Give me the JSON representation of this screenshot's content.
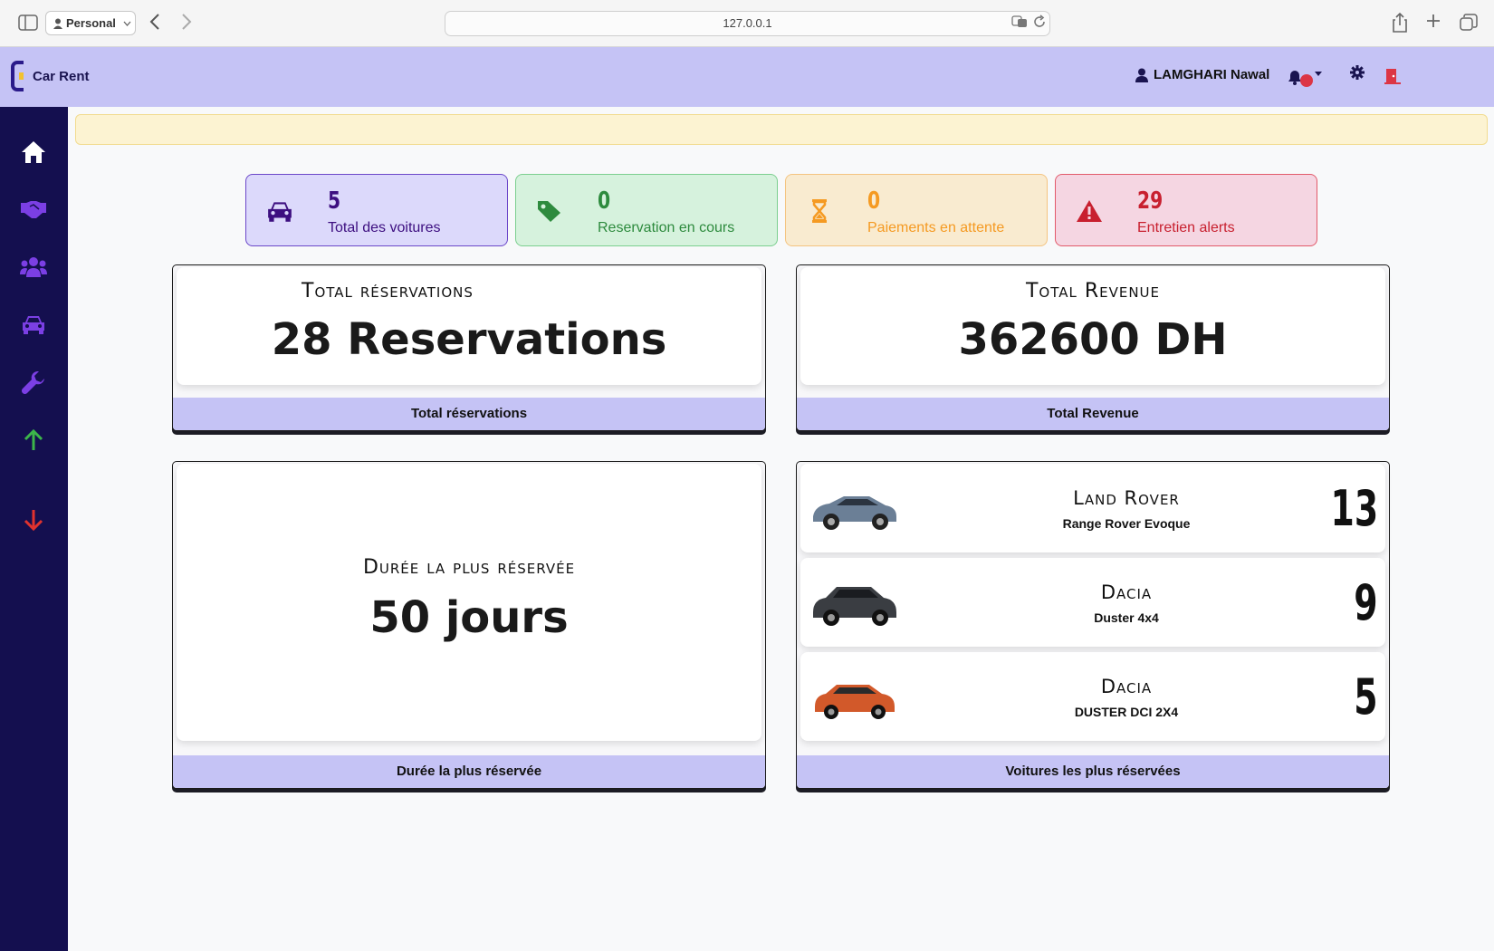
{
  "browser": {
    "profile_label": "Personal",
    "url": "127.0.0.1"
  },
  "header": {
    "app_name": "Car Rent",
    "user_name": "LAMGHARI Nawal"
  },
  "stats": [
    {
      "value": "5",
      "label": "Total des voitures",
      "icon": "car-icon"
    },
    {
      "value": "0",
      "label": "Reservation en cours",
      "icon": "tags-icon"
    },
    {
      "value": "0",
      "label": "Paiements en attente",
      "icon": "hourglass-icon"
    },
    {
      "value": "29",
      "label": "Entretien alerts",
      "icon": "warning-icon"
    }
  ],
  "panels": {
    "reservations": {
      "title": "Total réservations",
      "value": "28 Reservations",
      "footer": "Total réservations"
    },
    "revenue": {
      "title": "Total Revenue",
      "value": "362600 DH",
      "footer": "Total Revenue"
    },
    "duration": {
      "title": "Durée la plus réservée",
      "value": "50 jours",
      "footer": "Durée la plus réservée"
    },
    "top_cars": {
      "footer": "Voitures les plus réservées",
      "items": [
        {
          "brand": "Land Rover",
          "model": "Range Rover Evoque",
          "count": "13",
          "color": "#6b7f96"
        },
        {
          "brand": "Dacia",
          "model": "Duster 4x4",
          "count": "9",
          "color": "#3a3d42"
        },
        {
          "brand": "Dacia",
          "model": "DUSTER DCI 2X4",
          "count": "5",
          "color": "#d2592a"
        }
      ]
    }
  },
  "colors": {
    "sidebar": "#140f4f",
    "header": "#c5c3f5",
    "accent_purple": "#7b3fe4",
    "up_green": "#3cb54a",
    "down_red": "#e0322e"
  }
}
